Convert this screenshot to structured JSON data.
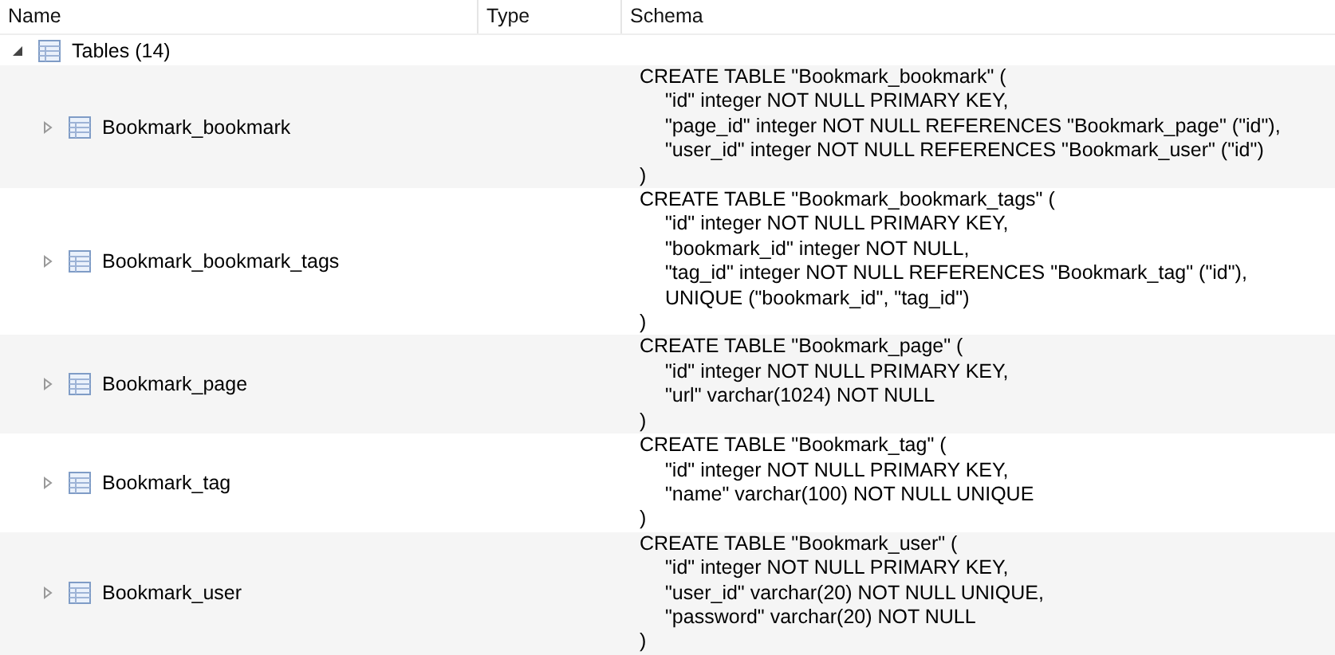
{
  "table": {
    "columns": [
      "Name",
      "Type",
      "Schema"
    ],
    "tree": {
      "label": "Tables (14)",
      "expanded": true,
      "children": [
        {
          "label": "Bookmark_bookmark",
          "expanded": false,
          "schema": [
            "CREATE TABLE \"Bookmark_bookmark\" (",
            "\"id\" integer NOT NULL PRIMARY KEY,",
            "\"page_id\" integer NOT NULL REFERENCES \"Bookmark_page\" (\"id\"),",
            "\"user_id\" integer NOT NULL REFERENCES \"Bookmark_user\" (\"id\")",
            ")"
          ]
        },
        {
          "label": "Bookmark_bookmark_tags",
          "expanded": false,
          "schema": [
            "CREATE TABLE \"Bookmark_bookmark_tags\" (",
            "\"id\" integer NOT NULL PRIMARY KEY,",
            "\"bookmark_id\" integer NOT NULL,",
            "\"tag_id\" integer NOT NULL REFERENCES \"Bookmark_tag\" (\"id\"),",
            "UNIQUE (\"bookmark_id\", \"tag_id\")",
            ")"
          ]
        },
        {
          "label": "Bookmark_page",
          "expanded": false,
          "schema": [
            "CREATE TABLE \"Bookmark_page\" (",
            "\"id\" integer NOT NULL PRIMARY KEY,",
            "\"url\" varchar(1024) NOT NULL",
            ")"
          ]
        },
        {
          "label": "Bookmark_tag",
          "expanded": false,
          "schema": [
            "CREATE TABLE \"Bookmark_tag\" (",
            "\"id\" integer NOT NULL PRIMARY KEY,",
            "\"name\" varchar(100) NOT NULL UNIQUE",
            ")"
          ]
        },
        {
          "label": "Bookmark_user",
          "expanded": false,
          "schema": [
            "CREATE TABLE \"Bookmark_user\" (",
            "\"id\" integer NOT NULL PRIMARY KEY,",
            "\"user_id\" varchar(20) NOT NULL UNIQUE,",
            "\"password\" varchar(20) NOT NULL",
            ")"
          ]
        }
      ]
    }
  }
}
